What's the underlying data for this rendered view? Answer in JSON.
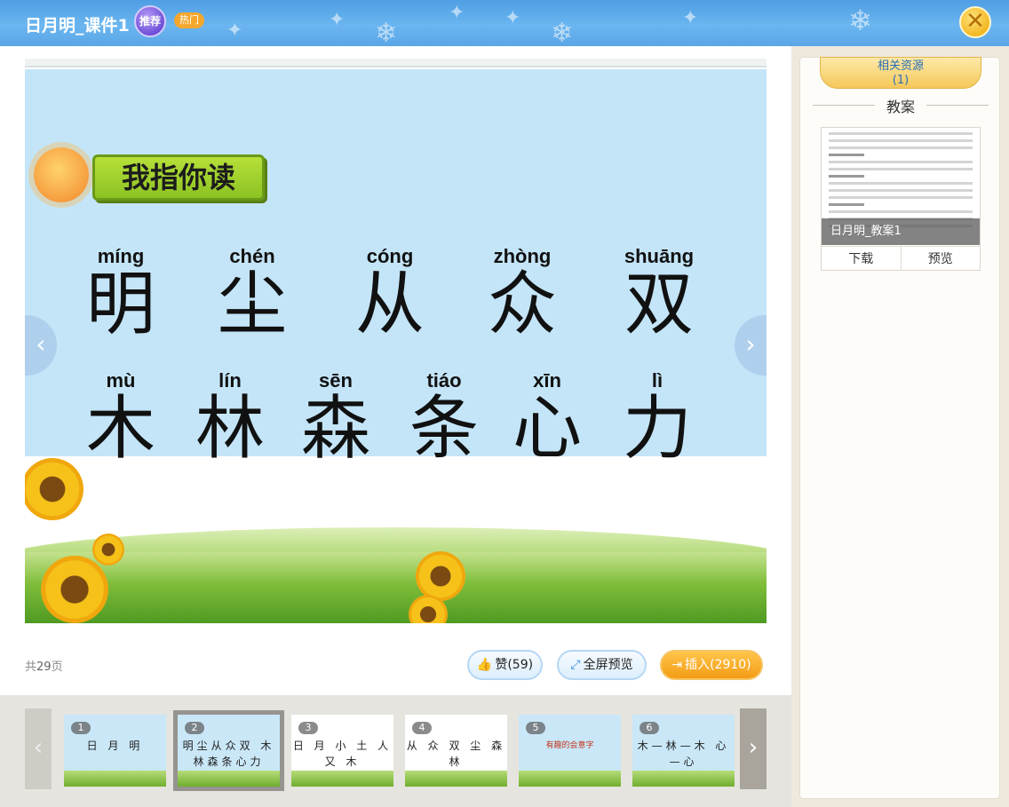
{
  "header": {
    "title": "日月明_课件1",
    "badge_recommend": "推荐",
    "badge_hot": "热门",
    "close_icon": "close-icon"
  },
  "slide": {
    "banner": "我指你读",
    "row1": [
      {
        "py": "míng",
        "hz": "明"
      },
      {
        "py": "chén",
        "hz": "尘"
      },
      {
        "py": "cóng",
        "hz": "从"
      },
      {
        "py": "zhòng",
        "hz": "众"
      },
      {
        "py": "shuāng",
        "hz": "双"
      }
    ],
    "row2": [
      {
        "py": "mù",
        "hz": "木"
      },
      {
        "py": "lín",
        "hz": "林"
      },
      {
        "py": "sēn",
        "hz": "森"
      },
      {
        "py": "tiáo",
        "hz": "条"
      },
      {
        "py": "xīn",
        "hz": "心"
      },
      {
        "py": "lì",
        "hz": "力"
      }
    ]
  },
  "footer": {
    "page_prefix": "共",
    "page_total": "29",
    "page_suffix": "页",
    "like_label": "赞(59)",
    "fullscreen_label": "全屏预览",
    "insert_label": "插入(2910)"
  },
  "thumbnails": [
    {
      "num": "1",
      "text": "日 月 明"
    },
    {
      "num": "2",
      "text": "明尘从众双 木林森条心力"
    },
    {
      "num": "3",
      "text": "日 月 小 土 人 又 木"
    },
    {
      "num": "4",
      "text": "从 众 双 尘 森 林"
    },
    {
      "num": "5",
      "text": "有趣的会意字"
    },
    {
      "num": "6",
      "text": "木—林—木 心—心"
    }
  ],
  "side": {
    "ribbon_title": "相关资源",
    "ribbon_count": "(1)",
    "section_title": "教案",
    "doc_caption": "日月明_教案1",
    "download_label": "下载",
    "preview_label": "预览"
  },
  "colors": {
    "header": "#5aa6e6",
    "accent_orange": "#f49c16",
    "slide_sky": "#c4e5f8",
    "banner_green": "#8cc322"
  }
}
